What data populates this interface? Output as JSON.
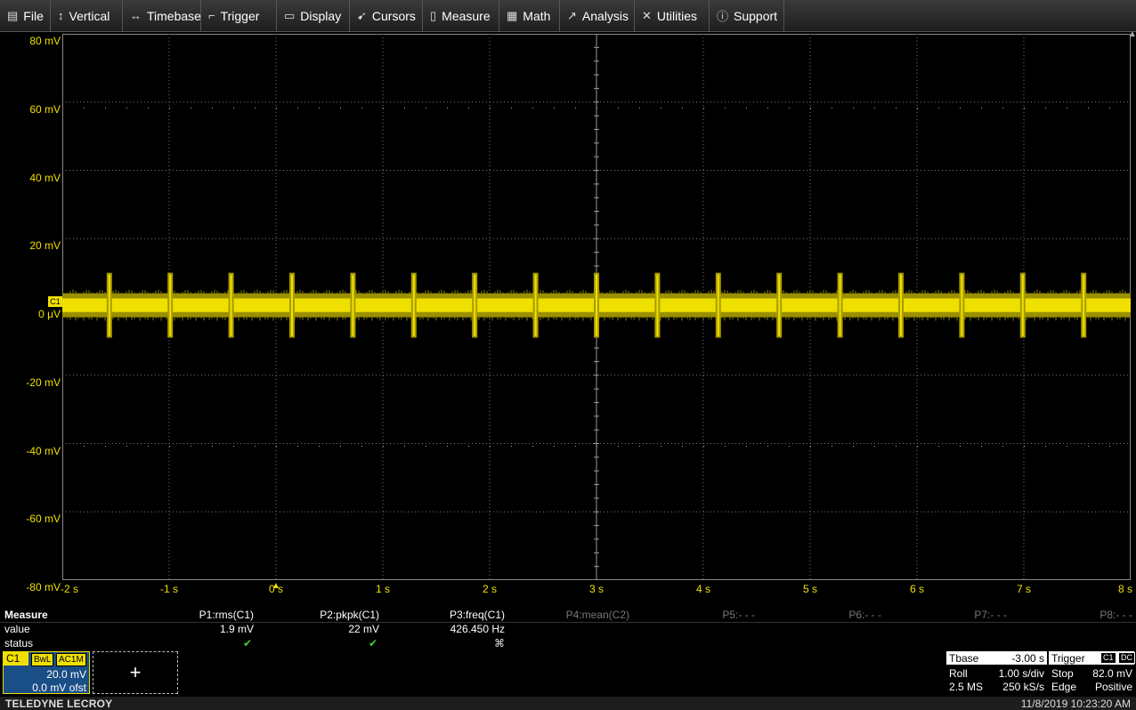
{
  "menu": [
    {
      "label": "File",
      "icon": "▤",
      "name": "file"
    },
    {
      "label": "Vertical",
      "icon": "↕",
      "name": "vertical"
    },
    {
      "label": "Timebase",
      "icon": "↔",
      "name": "timebase"
    },
    {
      "label": "Trigger",
      "icon": "⌐",
      "name": "trigger"
    },
    {
      "label": "Display",
      "icon": "▭",
      "name": "display"
    },
    {
      "label": "Cursors",
      "icon": "➹",
      "name": "cursors"
    },
    {
      "label": "Measure",
      "icon": "▯",
      "name": "measure"
    },
    {
      "label": "Math",
      "icon": "▦",
      "name": "math"
    },
    {
      "label": "Analysis",
      "icon": "↗",
      "name": "analysis"
    },
    {
      "label": "Utilities",
      "icon": "✕",
      "name": "utilities"
    },
    {
      "label": "Support",
      "icon": "ⓘ",
      "name": "support"
    }
  ],
  "y_axis_labels": [
    "80 mV",
    "60 mV",
    "40 mV",
    "20 mV",
    "0 μV",
    "-20 mV",
    "-40 mV",
    "-60 mV",
    "-80 mV"
  ],
  "x_axis_labels": [
    "-2 s",
    "-1 s",
    "0 s",
    "1 s",
    "2 s",
    "3 s",
    "4 s",
    "5 s",
    "6 s",
    "7 s",
    "8 s"
  ],
  "trace": {
    "label": "C1",
    "color": "#f0e000",
    "offset_mv": 0,
    "noise_band_mv": [
      -3,
      4
    ],
    "spike_band_mv": [
      -9,
      10
    ],
    "spike_period_s": 0.57,
    "first_spike_s": -1.56
  },
  "measure": {
    "title": "Measure",
    "row_labels": {
      "value": "value",
      "status": "status"
    },
    "params": [
      {
        "name": "P1:rms(C1)",
        "value": "1.9 mV",
        "status": "ok"
      },
      {
        "name": "P2:pkpk(C1)",
        "value": "22 mV",
        "status": "ok"
      },
      {
        "name": "P3:freq(C1)",
        "value": "426.450 Hz",
        "status": "warn"
      },
      {
        "name": "P4:mean(C2)",
        "value": "",
        "status": ""
      },
      {
        "name": "P5:- - -",
        "value": "",
        "status": ""
      },
      {
        "name": "P6:- - -",
        "value": "",
        "status": ""
      },
      {
        "name": "P7:- - -",
        "value": "",
        "status": ""
      },
      {
        "name": "P8:- - -",
        "value": "",
        "status": ""
      }
    ]
  },
  "channel": {
    "tag": "C1",
    "bwl": "BwL",
    "coupling": "AC1M",
    "vdiv": "20.0 mV",
    "offset": "0.0 mV ofst"
  },
  "add_button": "+",
  "timebase": {
    "title": "Tbase",
    "delay": "-3.00 s",
    "mode": "Roll",
    "tdiv": "1.00 s/div",
    "samples": "2.5 MS",
    "rate": "250 kS/s"
  },
  "trigger": {
    "title": "Trigger",
    "source": "C1",
    "coupling": "DC",
    "state": "Stop",
    "level": "82.0 mV",
    "type": "Edge",
    "slope": "Positive"
  },
  "footer": {
    "brand": "TELEDYNE LECROY",
    "datetime": "11/8/2019 10:23:20 AM"
  }
}
